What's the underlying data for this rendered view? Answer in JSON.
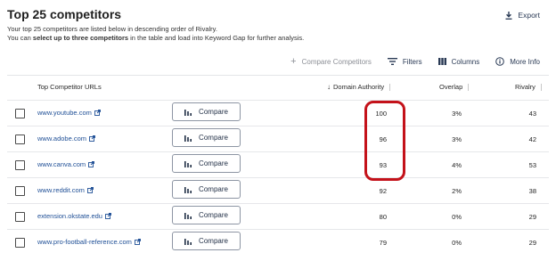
{
  "header": {
    "title": "Top 25 competitors",
    "subtitle_line1": "Your top 25 competitors are listed below in descending order of Rivalry.",
    "subtitle_line2_pre": "You can ",
    "subtitle_line2_bold": "select up to three competitors",
    "subtitle_line2_post": " in the table and load into Keyword Gap for further analysis.",
    "export_label": "Export"
  },
  "toolbar": {
    "compare_competitors": "Compare Competitors",
    "filters": "Filters",
    "columns": "Columns",
    "more_info": "More Info"
  },
  "table": {
    "columns": {
      "url": "Top Competitor URLs",
      "domain_authority": "Domain Authority",
      "overlap": "Overlap",
      "rivalry": "Rivalry"
    },
    "compare_label": "Compare",
    "rows": [
      {
        "url": "www.youtube.com",
        "da": "100",
        "overlap": "3%",
        "rivalry": "43"
      },
      {
        "url": "www.adobe.com",
        "da": "96",
        "overlap": "3%",
        "rivalry": "42"
      },
      {
        "url": "www.canva.com",
        "da": "93",
        "overlap": "4%",
        "rivalry": "53"
      },
      {
        "url": "www.reddit.com",
        "da": "92",
        "overlap": "2%",
        "rivalry": "38"
      },
      {
        "url": "extension.okstate.edu",
        "da": "80",
        "overlap": "0%",
        "rivalry": "29"
      },
      {
        "url": "www.pro-football-reference.com",
        "da": "79",
        "overlap": "0%",
        "rivalry": "29"
      }
    ]
  },
  "colors": {
    "accent": "#1f4f96",
    "highlight": "#c4121a"
  }
}
